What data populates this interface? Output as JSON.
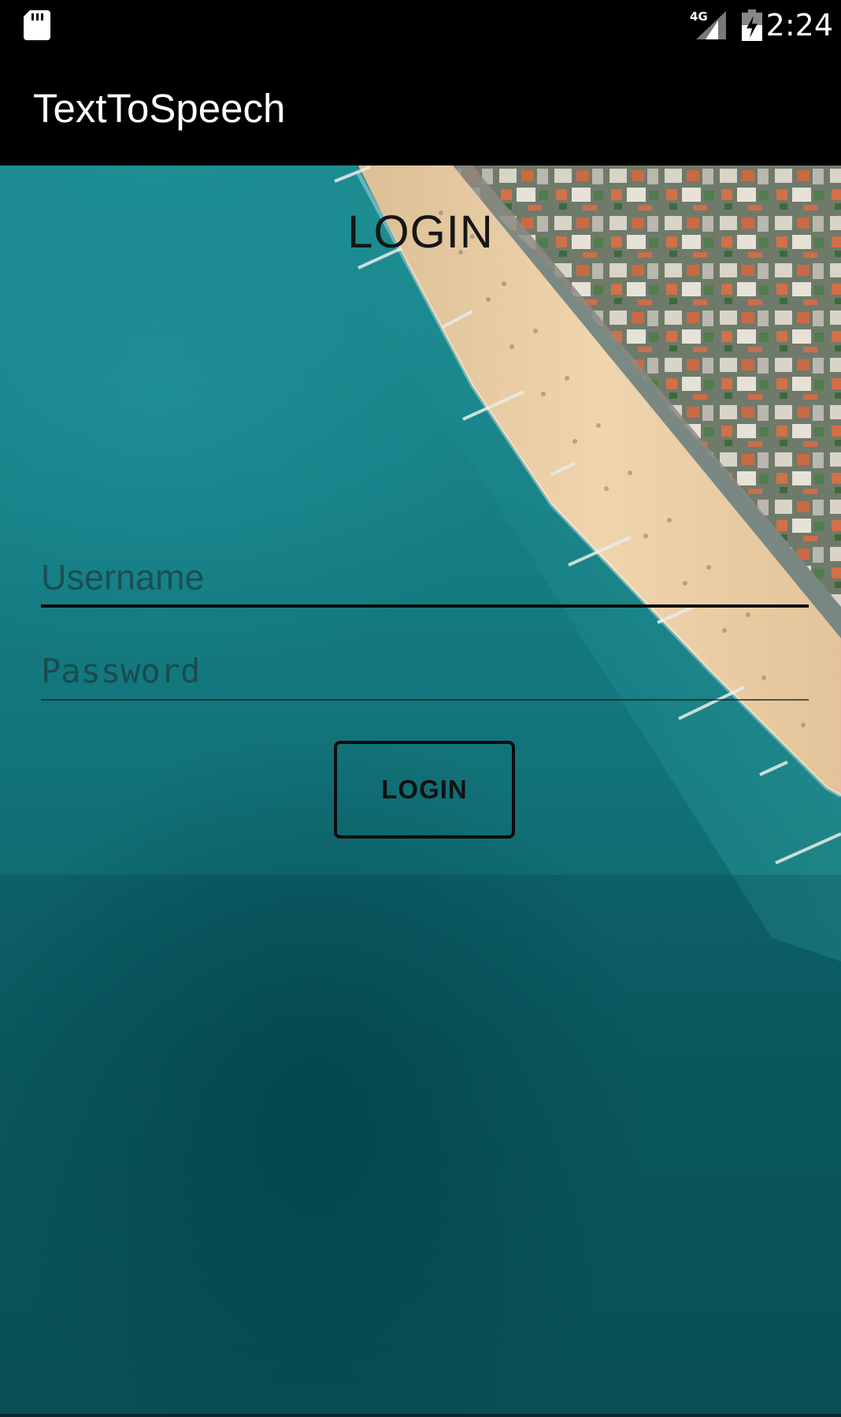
{
  "status_bar": {
    "time": "2:24",
    "network_label": "4G",
    "icons": [
      "sd-card-icon",
      "signal-icon",
      "battery-charging-icon"
    ]
  },
  "app_bar": {
    "title": "TextToSpeech"
  },
  "login": {
    "heading": "LOGIN",
    "username_placeholder": "Username",
    "username_value": "",
    "password_placeholder": "Password",
    "password_value": "",
    "button_label": "LOGIN"
  },
  "colors": {
    "status_bar_bg": "#000000",
    "app_bar_bg": "#000000",
    "sea": "#13787e",
    "sand": "#e9cba2",
    "text_dark": "#161616"
  }
}
